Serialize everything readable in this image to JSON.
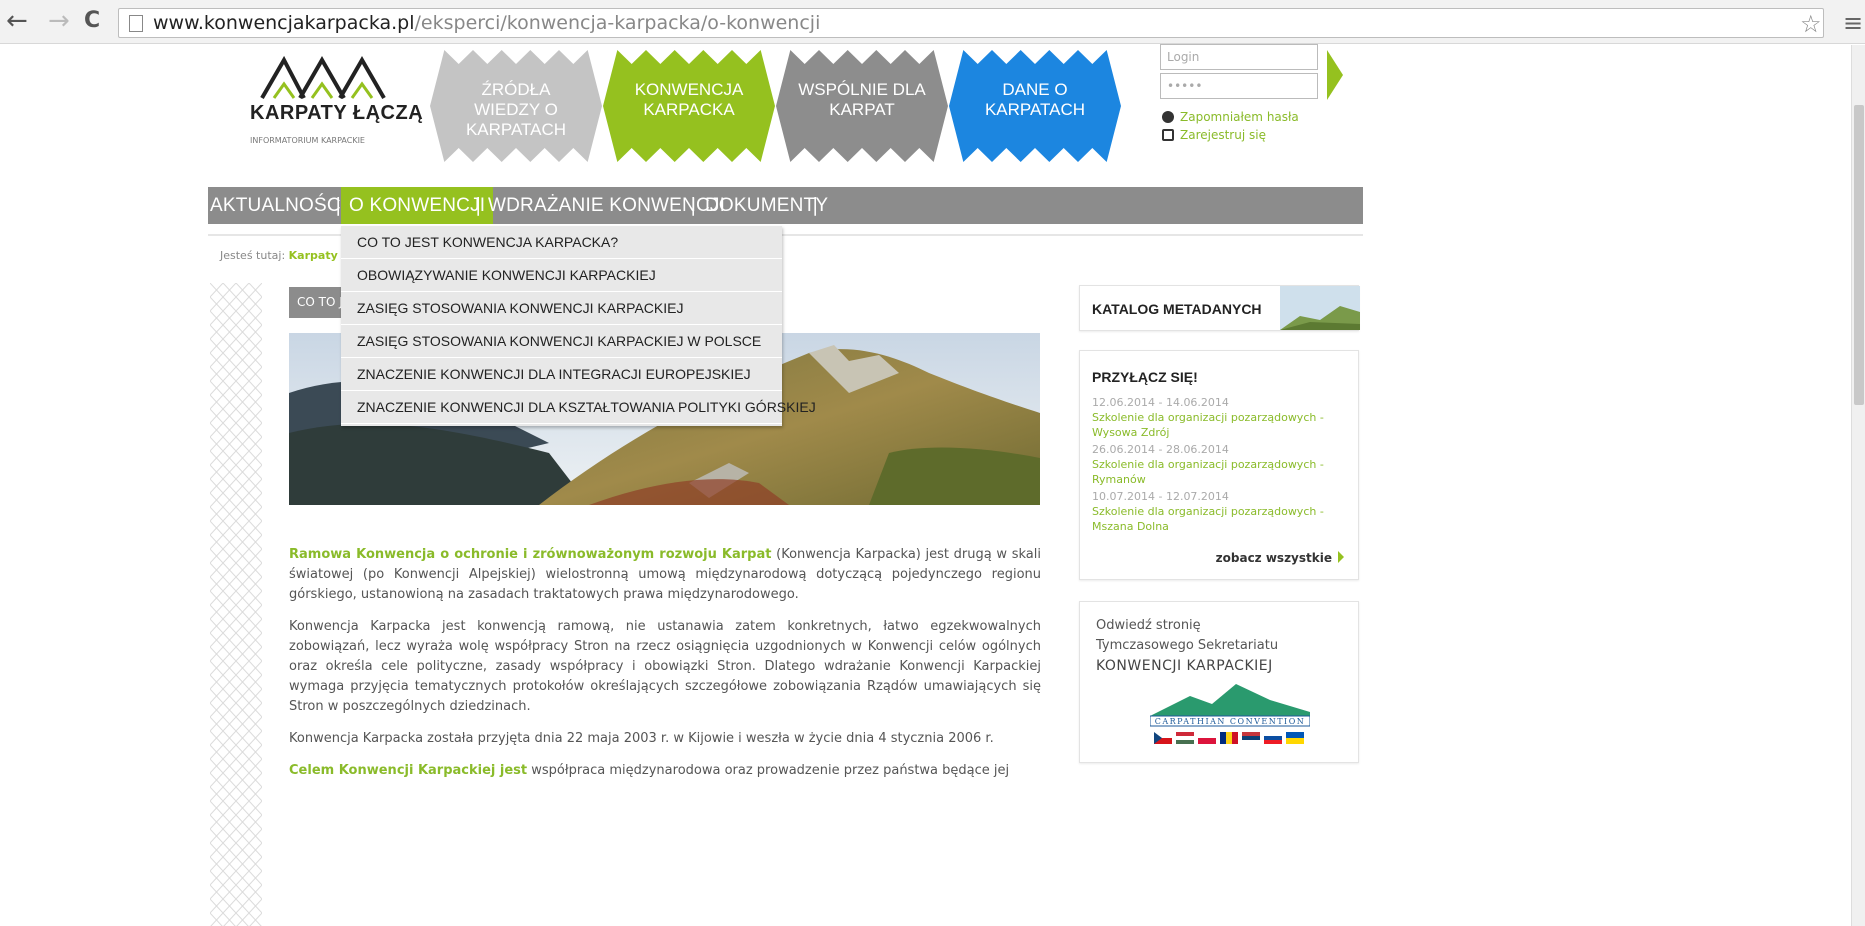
{
  "browser": {
    "url_host": "www.konwencjakarpacka.pl",
    "url_path": "/eksperci/konwencja-karpacka/o-konwencji",
    "back_icon": "←",
    "forward_icon": "→",
    "reload_icon": "C",
    "star_icon": "☆",
    "menu_icon": "≡"
  },
  "logo": {
    "name": "KARPATY ŁĄCZĄ",
    "subtitle": "INFORMATORIUM KARPACKIE"
  },
  "header_tiles": [
    {
      "label": "ŹRÓDŁA WIEDZY O KARPATACH",
      "color": "#c4c4c4"
    },
    {
      "label": "KONWENCJA KARPACKA",
      "color": "#95c11f"
    },
    {
      "label": "WSPÓLNIE DLA KARPAT",
      "color": "#8d8d8d"
    },
    {
      "label": "DANE O KARPATACH",
      "color": "#1c86e0"
    }
  ],
  "login": {
    "login_placeholder": "Login",
    "password_placeholder": "•••••",
    "forgot": "Zapomniałem hasła",
    "register": "Zarejestruj się"
  },
  "nav": {
    "items": [
      "AKTUALNOŚCI",
      "O KONWENCJI",
      "WDRAŻANIE KONWENCJI",
      "DOKUMENTY"
    ],
    "separator": "|"
  },
  "dropdown": [
    "CO TO JEST KONWENCJA KARPACKA?",
    "OBOWIĄZYWANIE KONWENCJI KARPACKIEJ",
    "ZASIĘG STOSOWANIA KONWENCJI KARPACKIEJ",
    "ZASIĘG STOSOWANIA KONWENCJI KARPACKIEJ W POLSCE",
    "ZNACZENIE KONWENCJI DLA INTEGRACJI EUROPEJSKIEJ",
    "ZNACZENIE KONWENCJI DLA KSZTAŁTOWANIA POLITYKI GÓRSKIEJ"
  ],
  "breadcrumb": {
    "prefix": "Jesteś tutaj:",
    "link": "Karpaty"
  },
  "page_tab": "CO TO J",
  "article": {
    "p1_highlight": "Ramowa Konwencja o ochronie i zrównoważonym rozwoju Karpat",
    "p1_rest": " (Konwencja Karpacka) jest drugą w skali światowej (po Konwencji Alpejskiej) wielostronną umową międzynarodową dotyczącą pojedynczego regionu górskiego, ustanowioną na zasadach traktatowych prawa międzynarodowego.",
    "p2": "Konwencja Karpacka jest konwencją ramową, nie ustanawia zatem konkretnych, łatwo egzekwowalnych zobowiązań, lecz wyraża wolę współpracy Stron na rzecz osiągnięcia uzgodnionych w Konwencji celów ogólnych oraz określa cele polityczne, zasady współpracy i obowiązki Stron. Dlatego wdrażanie Konwencji Karpackiej wymaga przyjęcia tematycznych protokołów określających szczegółowe zobowiązania Rządów umawiających się Stron w poszczególnych dziedzinach.",
    "p3": "Konwencja Karpacka została przyjęta dnia 22 maja 2003 r. w Kijowie i weszła w życie dnia 4 stycznia 2006 r.",
    "p4_highlight": "Celem Konwencji Karpackiej jest",
    "p4_rest": " współpraca międzynarodowa oraz prowadzenie przez państwa będące jej"
  },
  "sidebar": {
    "katalog": "KATALOG METADANYCH",
    "join_title": "PRZYŁĄCZ SIĘ!",
    "events": [
      {
        "date": "12.06.2014 - 14.06.2014",
        "name": "Szkolenie dla organizacji pozarządowych - Wysowa Zdrój"
      },
      {
        "date": "26.06.2014 - 28.06.2014",
        "name": "Szkolenie dla organizacji pozarządowych - Rymanów"
      },
      {
        "date": "10.07.2014 - 12.07.2014",
        "name": "Szkolenie dla organizacji pozarządowych - Mszana Dolna"
      }
    ],
    "see_all": "zobacz wszystkie",
    "sekr_line1": "Odwiedź stronię",
    "sekr_line2": "Tymczasowego Sekretariatu",
    "sekr_line3": "KONWENCJI KARPACKIEJ",
    "carpathian_logo": "CARPATHIAN CONVENTION"
  }
}
